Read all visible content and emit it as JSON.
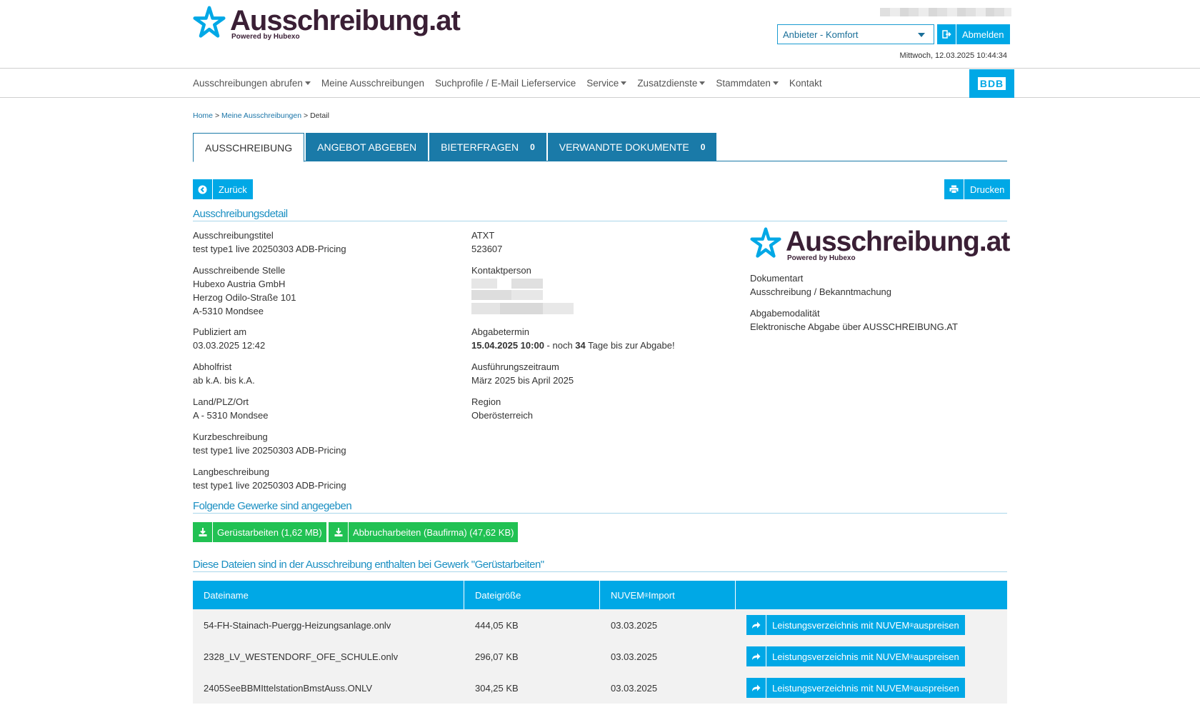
{
  "header": {
    "logo_title": "Ausschreibung.at",
    "logo_sub": "Powered by Hubexo",
    "role_select": "Anbieter - Komfort",
    "logout": "Abmelden",
    "date": "Mittwoch, 12.03.2025 10:44:34",
    "bdb": "BDB"
  },
  "nav": [
    {
      "label": "Ausschreibungen abrufen",
      "dropdown": true
    },
    {
      "label": "Meine Ausschreibungen",
      "dropdown": false
    },
    {
      "label": "Suchprofile / E-Mail Lieferservice",
      "dropdown": false
    },
    {
      "label": "Service",
      "dropdown": true
    },
    {
      "label": "Zusatzdienste",
      "dropdown": true
    },
    {
      "label": "Stammdaten",
      "dropdown": true
    },
    {
      "label": "Kontakt",
      "dropdown": false
    }
  ],
  "breadcrumb": {
    "home": "Home",
    "sep": ">",
    "mine": "Meine Ausschreibungen",
    "current": "Detail"
  },
  "tabs": [
    {
      "label": "AUSSCHREIBUNG",
      "count": ""
    },
    {
      "label": "ANGEBOT ABGEBEN",
      "count": ""
    },
    {
      "label": "BIETERFRAGEN",
      "count": "0"
    },
    {
      "label": "VERWANDTE DOKUMENTE",
      "count": "0"
    }
  ],
  "actions": {
    "back": "Zurück",
    "print": "Drucken"
  },
  "detail": {
    "heading": "Ausschreibungsdetail",
    "title_label": "Ausschreibungstitel",
    "title_value": "test type1 live 20250303 ADB-Pricing",
    "stelle_label": "Ausschreibende Stelle",
    "stelle_line1": "Hubexo Austria GmbH",
    "stelle_line2": "Herzog Odilo-Straße 101",
    "stelle_line3": "A-5310 Mondsee",
    "pub_label": "Publiziert am",
    "pub_value": "03.03.2025 12:42",
    "abhol_label": "Abholfrist",
    "abhol_value": "ab k.A. bis k.A.",
    "ort_label": "Land/PLZ/Ort",
    "ort_value": "A - 5310 Mondsee",
    "kurz_label": "Kurzbeschreibung",
    "kurz_value": "test type1 live 20250303 ADB-Pricing",
    "lang_label": "Langbeschreibung",
    "lang_value": "test type1 live 20250303 ADB-Pricing",
    "atxt_label": "ATXT",
    "atxt_value": "523607",
    "kontakt_label": "Kontaktperson",
    "abgabe_label": "Abgabetermin",
    "abgabe_date": "15.04.2025 10:00",
    "abgabe_mid": " - noch ",
    "abgabe_days": "34",
    "abgabe_tail": " Tage bis zur Abgabe!",
    "ausf_label": "Ausführungszeitraum",
    "ausf_value": "März 2025 bis April 2025",
    "region_label": "Region",
    "region_value": "Oberösterreich",
    "dokart_label": "Dokumentart",
    "dokart_value": "Ausschreibung / Bekanntmachung",
    "modal_label": "Abgabemodalität",
    "modal_value": "Elektronische Abgabe über AUSSCHREIBUNG.AT"
  },
  "gewerke": {
    "heading": "Folgende Gewerke sind angegeben",
    "items": [
      "Gerüstarbeiten (1,62 MB)",
      "Abbrucharbeiten (Baufirma) (47,62 KB)"
    ]
  },
  "files": {
    "heading": "Diese Dateien sind in der Ausschreibung enthalten bei Gewerk \"Gerüstarbeiten\"",
    "columns": {
      "name": "Dateiname",
      "size": "Dateigröße",
      "import_pre": "NUVEM",
      "import_post": " Import"
    },
    "btn_pre": "Leistungsverzeichnis mit NUVEM",
    "btn_post": " auspreisen",
    "reg": "®",
    "rows": [
      {
        "name": "54-FH-Stainach-Puergg-Heizungsanlage.onlv",
        "size": "444,05 KB",
        "date": "03.03.2025"
      },
      {
        "name": "2328_LV_WESTENDORF_OFE_SCHULE.onlv",
        "size": "296,07 KB",
        "date": "03.03.2025"
      },
      {
        "name": "2405SeeBBMIttelstationBmstAuss.ONLV",
        "size": "304,25 KB",
        "date": "03.03.2025"
      }
    ]
  },
  "colors": {
    "accent": "#00a8e6",
    "tab": "#1a7aa8",
    "green": "#21c153",
    "brand": "#3a1f35"
  }
}
